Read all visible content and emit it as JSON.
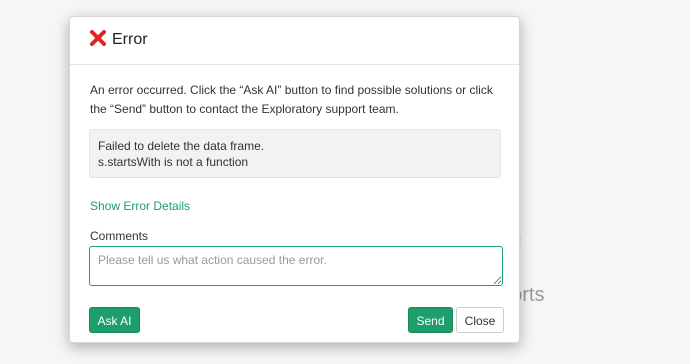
{
  "background": {
    "text1": "es",
    "text2": "ports"
  },
  "dialog": {
    "title": "Error",
    "icon": "error-x-icon",
    "icon_color": "#e02424",
    "message": "An error occurred. Click the “Ask AI” button to find possible solutions or click the “Send” button to contact the Exploratory support team.",
    "error_lines": [
      "Failed to delete the data frame.",
      "s.startsWith is not a function"
    ],
    "details_link": "Show Error Details",
    "comments_label": "Comments",
    "comments_placeholder": "Please tell us what action caused the error.",
    "comments_value": "",
    "buttons": {
      "ask_ai": "Ask AI",
      "send": "Send",
      "close": "Close"
    }
  },
  "colors": {
    "accent": "#1d9e6a",
    "error": "#e02424"
  }
}
